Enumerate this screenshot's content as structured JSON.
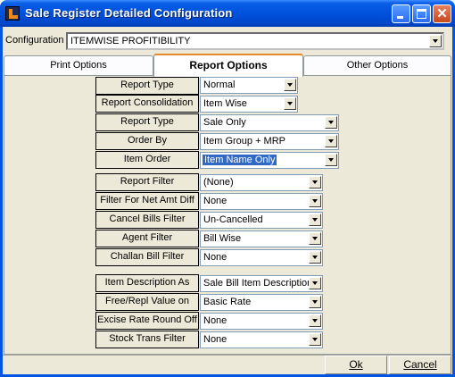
{
  "window": {
    "title": "Sale Register Detailed Configuration"
  },
  "config": {
    "label": "Configuration",
    "value": "ITEMWISE PROFITIBILITY"
  },
  "tabs": [
    {
      "label": "Print Options"
    },
    {
      "label": "Report Options"
    },
    {
      "label": "Other Options"
    }
  ],
  "fields": [
    {
      "label": "Report Type",
      "value": "Normal"
    },
    {
      "label": "Report Consolidation",
      "value": "Item Wise"
    },
    {
      "label": "Report Type",
      "value": "Sale Only"
    },
    {
      "label": "Order By",
      "value": "Item Group + MRP"
    },
    {
      "label": "Item Order",
      "value": "Item Name Only"
    },
    {
      "label": "Report Filter",
      "value": "(None)"
    },
    {
      "label": "Filter For Net Amt Diff",
      "value": "None"
    },
    {
      "label": "Cancel Bills Filter",
      "value": "Un-Cancelled"
    },
    {
      "label": "Agent Filter",
      "value": "Bill Wise"
    },
    {
      "label": "Challan Bill Filter",
      "value": "None"
    },
    {
      "label": "Item Description As",
      "value": "Sale Bill Item Description"
    },
    {
      "label": "Free/Repl Value on",
      "value": "Basic Rate"
    },
    {
      "label": "Excise Rate Round Off",
      "value": "None"
    },
    {
      "label": "Stock Trans Filter",
      "value": "None"
    }
  ],
  "buttons": {
    "ok": "Ok",
    "cancel": "Cancel"
  },
  "colors": {
    "title_bar": "#0054e3",
    "window_bg": "#ece9d8",
    "selection": "#316ac5",
    "active_tab_accent": "#e68b2c"
  }
}
